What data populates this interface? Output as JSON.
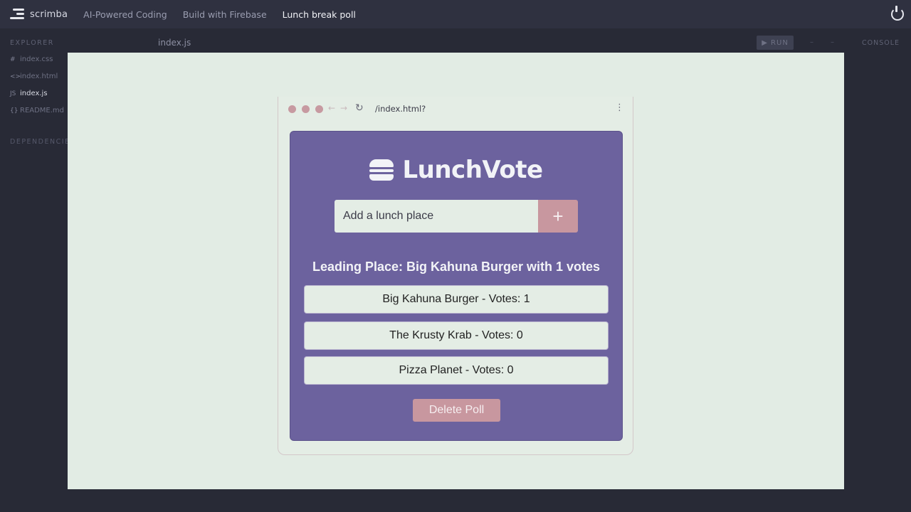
{
  "topbar": {
    "logo_text": "scrimba",
    "crumbs": [
      "AI-Powered Coding",
      "Build with Firebase",
      "Lunch break poll"
    ]
  },
  "explorer": {
    "title": "EXPLORER",
    "files": [
      {
        "icon": "#",
        "name": "index.css"
      },
      {
        "icon": "<>",
        "name": "index.html"
      },
      {
        "icon": "JS",
        "name": "index.js"
      },
      {
        "icon": "{}",
        "name": "README.md"
      }
    ],
    "dependencies_title": "DEPENDENCIES"
  },
  "editor": {
    "active_tab": "index.js"
  },
  "toolbar": {
    "run_label": "▶ RUN",
    "console_label": "CONSOLE"
  },
  "browser": {
    "url": "/index.html?"
  },
  "app": {
    "brand": "LunchVote",
    "input_placeholder": "Add a lunch place",
    "add_button": "+",
    "leading": "Leading Place: Big Kahuna Burger with 1 votes",
    "options": [
      "Big Kahuna Burger - Votes: 1",
      "The Krusty Krab - Votes: 0",
      "Pizza Planet - Votes: 0"
    ],
    "delete_button": "Delete Poll"
  },
  "colors": {
    "card": "#6c629e",
    "accent": "#c8979f",
    "preview_bg": "#e2ece4"
  }
}
